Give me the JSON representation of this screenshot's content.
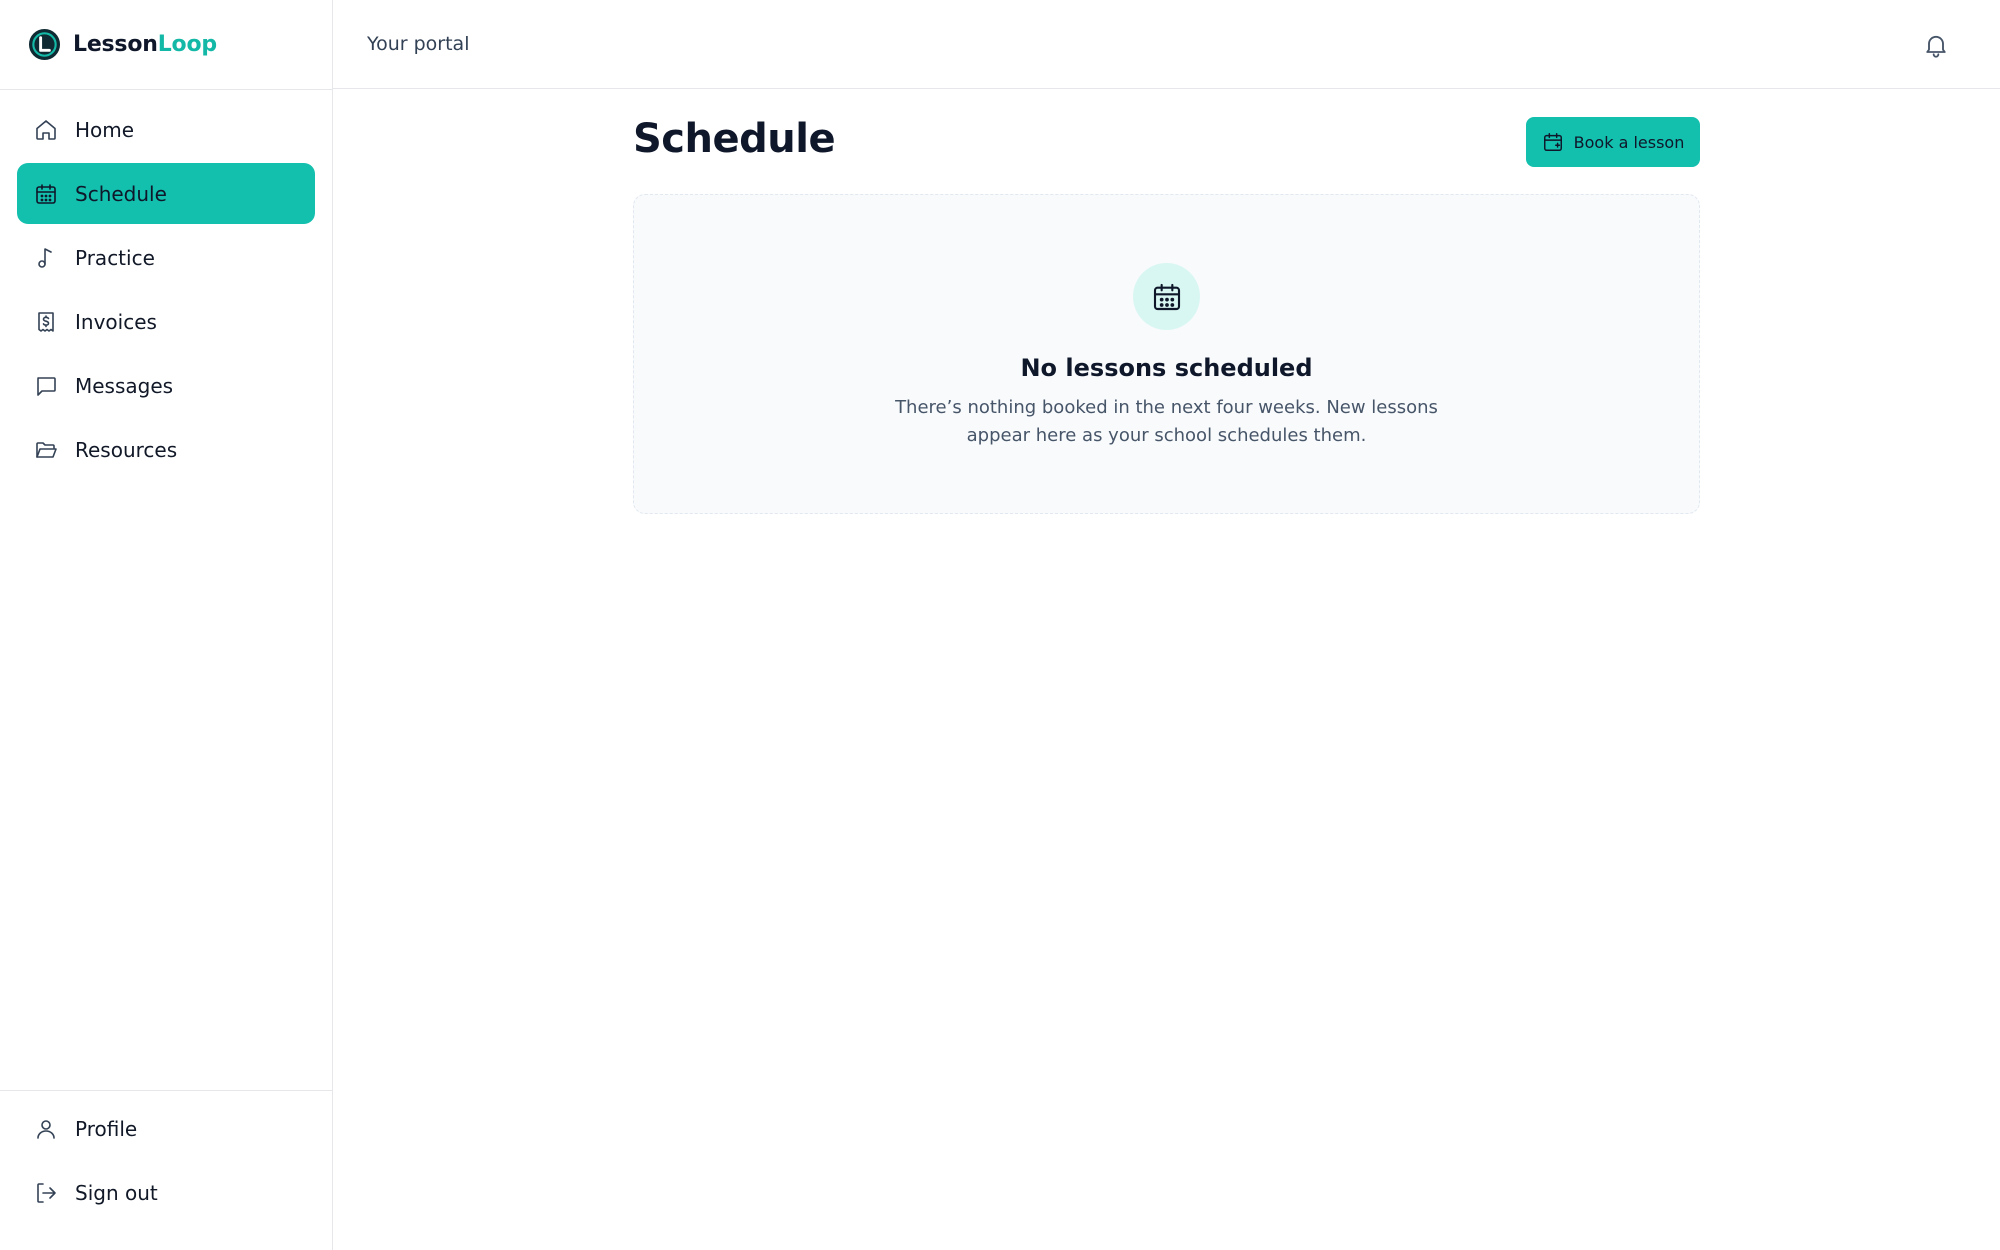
{
  "brand": {
    "name_primary": "Lesson",
    "name_accent": "Loop"
  },
  "topbar": {
    "title": "Your portal"
  },
  "sidebar": {
    "items": [
      {
        "label": "Home",
        "icon": "home-icon",
        "active": false
      },
      {
        "label": "Schedule",
        "icon": "calendar-icon",
        "active": true
      },
      {
        "label": "Practice",
        "icon": "music-note-icon",
        "active": false
      },
      {
        "label": "Invoices",
        "icon": "receipt-dollar-icon",
        "active": false
      },
      {
        "label": "Messages",
        "icon": "message-square-icon",
        "active": false
      },
      {
        "label": "Resources",
        "icon": "folder-open-icon",
        "active": false
      }
    ],
    "bottom": [
      {
        "label": "Profile",
        "icon": "user-icon"
      },
      {
        "label": "Sign out",
        "icon": "log-out-icon"
      }
    ]
  },
  "main": {
    "title": "Schedule",
    "book_button": "Book a lesson",
    "empty": {
      "title": "No lessons scheduled",
      "text": "There’s nothing booked in the next four weeks. New lessons appear here as your school schedules them."
    }
  },
  "colors": {
    "accent": "#13bfad",
    "accent_soft": "#d9f7f2",
    "text": "#0f172a"
  }
}
